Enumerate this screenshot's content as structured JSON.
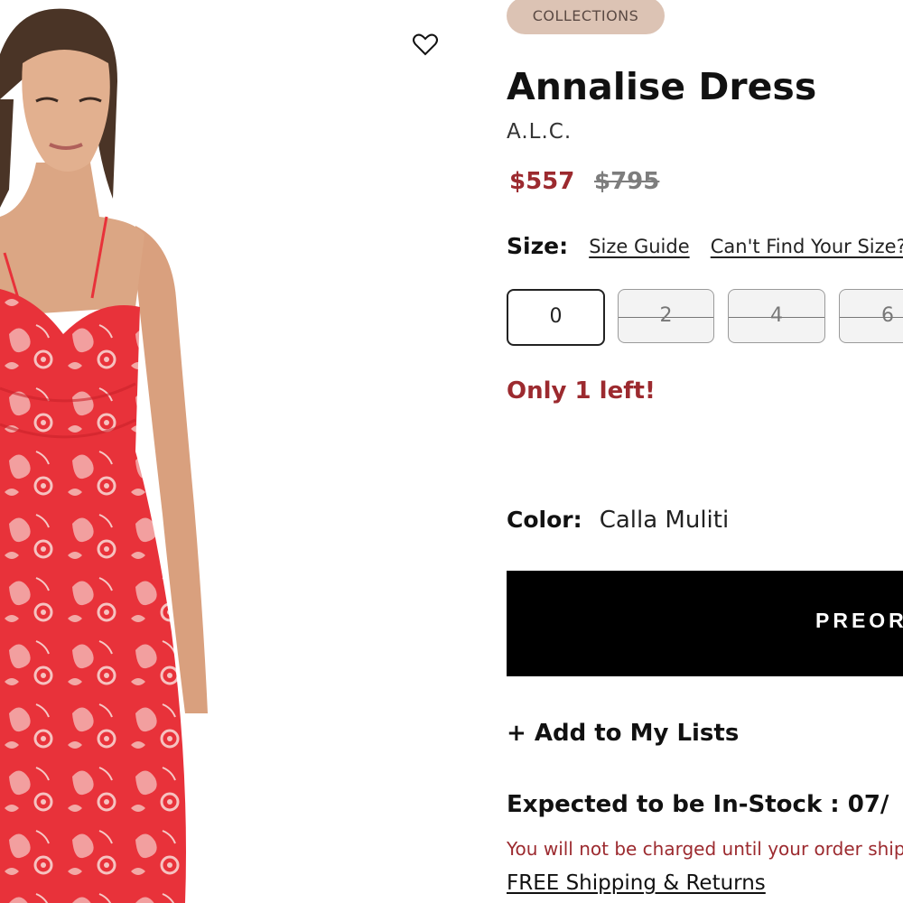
{
  "product": {
    "collection_badge": "COLLECTIONS",
    "name": "Annalise Dress",
    "brand": "A.L.C.",
    "price_sale": "$557",
    "price_original": "$795",
    "favorite_icon": "heart-outline-icon"
  },
  "size": {
    "label": "Size:",
    "guide_link": "Size Guide",
    "cant_find_link": "Can't Find Your Size?",
    "options": [
      {
        "label": "0",
        "available": true
      },
      {
        "label": "2",
        "available": false
      },
      {
        "label": "4",
        "available": false
      },
      {
        "label": "6",
        "available": false
      }
    ]
  },
  "stock_message": "Only 1 left!",
  "color": {
    "label": "Color:",
    "value": "Calla Muliti"
  },
  "preorder_button": "PREORDER",
  "add_to_lists": "+ Add to My Lists",
  "expected_stock": "Expected to be In-Stock : 07/",
  "charge_note": "You will not be charged until your order ships",
  "shipping_link": "FREE Shipping & Returns",
  "colors": {
    "sale_red": "#9c2a2f",
    "badge_bg": "#dcc3b4",
    "dress_red": "#e8323a"
  }
}
